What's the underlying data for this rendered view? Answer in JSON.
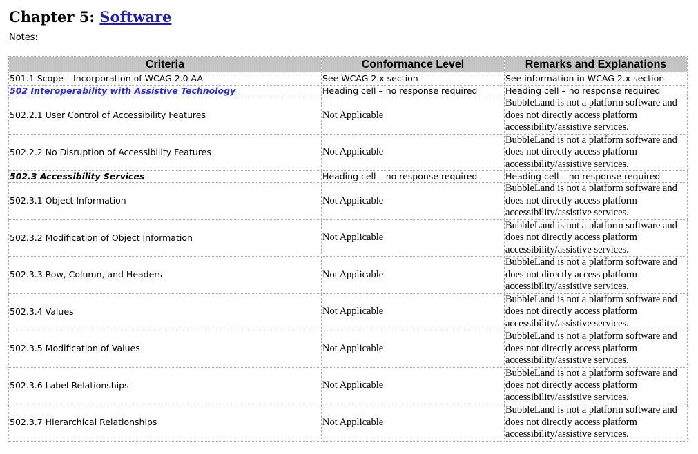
{
  "page": {
    "chapter_prefix": "Chapter 5: ",
    "chapter_link": "Software",
    "notes": "Notes:"
  },
  "table": {
    "headers": [
      "Criteria",
      "Conformance Level",
      "Remarks and Explanations"
    ],
    "rows": [
      {
        "kind": "simple",
        "criteria": "501.1 Scope – Incorporation of WCAG 2.0 AA",
        "level": "See WCAG 2.x section",
        "remarks": "See information in WCAG 2.x section"
      },
      {
        "kind": "heading",
        "criteria": "502 Interoperability with Assistive Technology",
        "link": true,
        "level": "Heading cell – no response required",
        "remarks": "Heading cell – no response required"
      },
      {
        "kind": "tall",
        "criteria": "502.2.1 User Control of Accessibility Features",
        "level": "Not Applicable",
        "remarks": "BubbleLand is not a platform software and does not directly access platform accessibility/assistive services."
      },
      {
        "kind": "tall",
        "criteria": "502.2.2 No Disruption of Accessibility Features",
        "level": "Not Applicable",
        "remarks": "BubbleLand is not a platform software and does not directly access platform accessibility/assistive services."
      },
      {
        "kind": "heading",
        "criteria": "502.3 Accessibility Services",
        "link": false,
        "level": "Heading cell – no response required",
        "remarks": "Heading cell – no response required"
      },
      {
        "kind": "tall",
        "criteria": "502.3.1 Object Information",
        "level": "Not Applicable",
        "remarks": "BubbleLand is not a platform software and does not directly access platform accessibility/assistive services."
      },
      {
        "kind": "tall",
        "criteria": "502.3.2 Modification of Object Information",
        "level": "Not Applicable",
        "remarks": "BubbleLand is not a platform software and does not directly access platform accessibility/assistive services."
      },
      {
        "kind": "tall",
        "criteria": "502.3.3 Row, Column, and Headers",
        "level": "Not Applicable",
        "remarks": "BubbleLand is not a platform software and does not directly access platform accessibility/assistive services."
      },
      {
        "kind": "tall",
        "criteria": "502.3.4 Values",
        "level": "Not Applicable",
        "remarks": "BubbleLand is not a platform software and does not directly access platform accessibility/assistive services."
      },
      {
        "kind": "tall",
        "criteria": "502.3.5 Modification of Values",
        "level": "Not Applicable",
        "remarks": "BubbleLand is not a platform software and does not directly access platform accessibility/assistive services."
      },
      {
        "kind": "tall",
        "criteria": "502.3.6 Label Relationships",
        "level": "Not Applicable",
        "remarks": "BubbleLand is not a platform software and does not directly access platform accessibility/assistive services."
      },
      {
        "kind": "tall",
        "criteria": "502.3.7 Hierarchical Relationships",
        "level": "Not Applicable",
        "remarks": "BubbleLand is not a platform software and does not directly access platform accessibility/assistive services."
      }
    ]
  }
}
